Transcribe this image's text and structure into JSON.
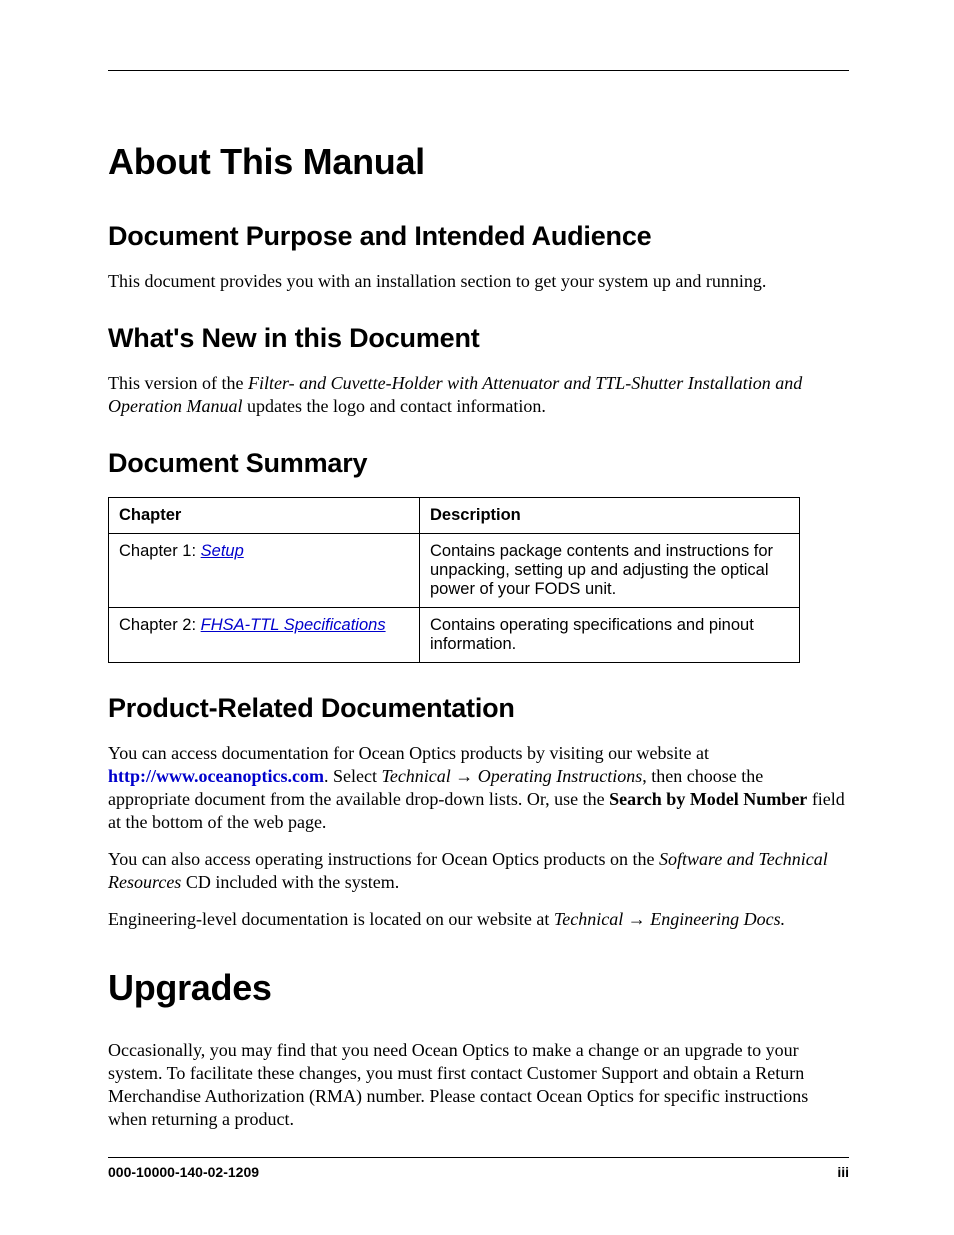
{
  "heading1": "About This Manual",
  "section1": {
    "heading": "Document Purpose and Intended Audience",
    "para": "This document provides you with an installation section to get your system up and running."
  },
  "section2": {
    "heading": "What's New in this Document",
    "para_pre": "This version of the ",
    "para_italic": "Filter- and Cuvette-Holder with Attenuator and TTL-Shutter  Installation and Operation Manual",
    "para_post": " updates the logo and contact information."
  },
  "section3": {
    "heading": "Document Summary",
    "th1": "Chapter",
    "th2": "Description",
    "rows": [
      {
        "chap_prefix": "Chapter 1: ",
        "chap_link": "Setup",
        "desc": "Contains package contents and instructions for unpacking, setting up and adjusting the optical power of your FODS unit."
      },
      {
        "chap_prefix": "Chapter 2: ",
        "chap_link": "FHSA-TTL Specifications",
        "desc": "Contains operating specifications and pinout information."
      }
    ]
  },
  "section4": {
    "heading": "Product-Related Documentation",
    "p1_pre": "You can access documentation for Ocean Optics products by visiting our website at ",
    "p1_link": "http://www.oceanoptics.com",
    "p1_mid1": ". Select ",
    "p1_it1": "Technical → Operating Instructions",
    "p1_mid2": ", then choose the appropriate document from the available drop-down lists. Or, use the ",
    "p1_bold": "Search by Model Number",
    "p1_post": " field at the bottom of the web page.",
    "p2_pre": "You can also access operating instructions for Ocean Optics products on the ",
    "p2_it": "Software and Technical Resources",
    "p2_post": " CD included with the system.",
    "p3_pre": "Engineering-level documentation is located on our website at ",
    "p3_it": "Technical → Engineering Docs."
  },
  "heading2": "Upgrades",
  "upgrades_para": "Occasionally, you may find that you need Ocean Optics to make a change or an upgrade to your system. To facilitate these changes, you must first contact Customer Support and obtain a Return Merchandise Authorization (RMA) number. Please contact Ocean Optics for specific instructions when returning a product.",
  "footer": {
    "left": "000-10000-140-02-1209",
    "right": "iii"
  }
}
